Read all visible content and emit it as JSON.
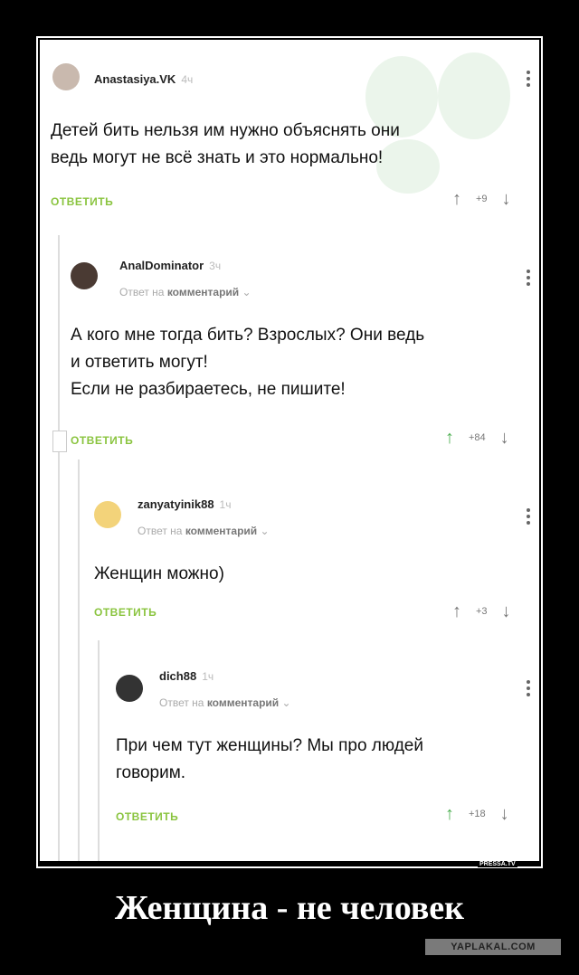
{
  "comments": [
    {
      "author": "Anastasiya.VK",
      "time": "4ч",
      "reply_to": "",
      "text_lines": [
        "Детей бить нельзя им нужно объяснять они",
        "ведь могут не всё знать и это нормально!"
      ],
      "reply_label": "ОТВЕТИТЬ",
      "score": "+9"
    },
    {
      "author": "AnalDominator",
      "time": "3ч",
      "reply_to_prefix": "Ответ на",
      "reply_to_target": "комментарий",
      "text_lines": [
        "А кого мне тогда бить? Взрослых? Они ведь",
        "и ответить могут!",
        "Если не разбираетесь, не пишите!"
      ],
      "reply_label": "ОТВЕТИТЬ",
      "score": "+84"
    },
    {
      "author": "zanyatyinik88",
      "time": "1ч",
      "reply_to_prefix": "Ответ на",
      "reply_to_target": "комментарий",
      "text_lines": [
        "Женщин можно)"
      ],
      "reply_label": "ОТВЕТИТЬ",
      "score": "+3"
    },
    {
      "author": "dich88",
      "time": "1ч",
      "reply_to_prefix": "Ответ на",
      "reply_to_target": "комментарий",
      "text_lines": [
        "При чем тут женщины? Мы про людей",
        "говорим."
      ],
      "reply_label": "ОТВЕТИТЬ",
      "score": "+18"
    }
  ],
  "icons": {
    "up": "arrow-up-icon",
    "down": "arrow-down-icon",
    "more": "more-vertical-icon",
    "chevron": "chevron-down-icon"
  },
  "colors": {
    "reply_green": "#8ac43f",
    "upvote_green": "#4caf50"
  },
  "caption": "Женщина - не человек",
  "source_tag": "PRESSA.TV",
  "site_tag": "YAPLAKAL.COM"
}
